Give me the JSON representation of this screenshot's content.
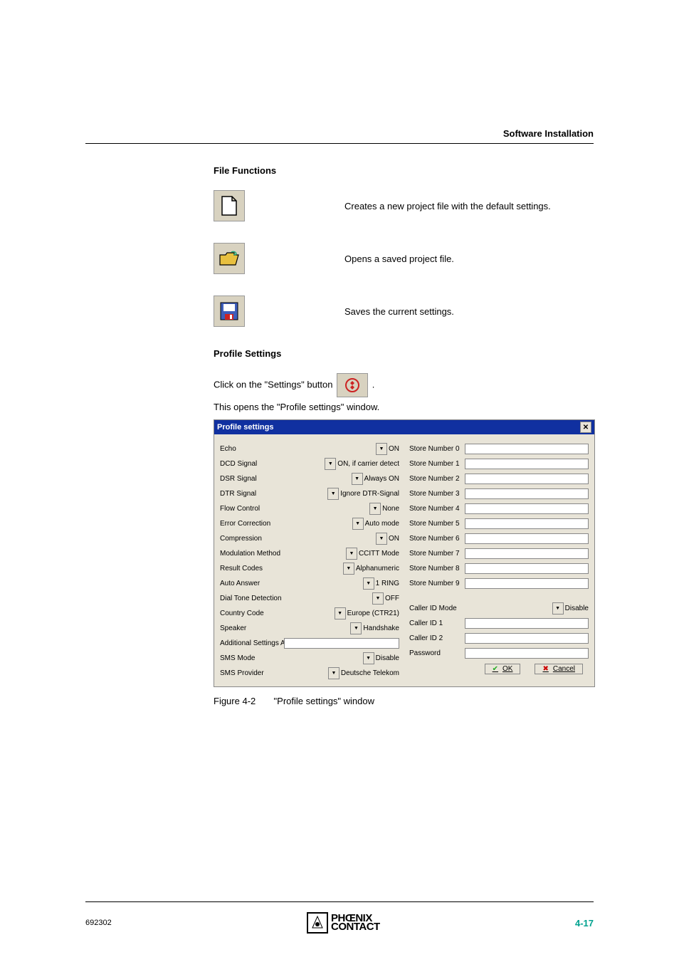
{
  "header": {
    "section": "Software Installation"
  },
  "fileFunctions": {
    "title": "File Functions",
    "items": [
      {
        "desc": "Creates a new project file with the default settings."
      },
      {
        "desc": "Opens a saved project file."
      },
      {
        "desc": "Saves the current settings."
      }
    ]
  },
  "profile": {
    "title": "Profile Settings",
    "line1a": "Click on the \"Settings\" button ",
    "line1b": ".",
    "line2": "This opens the \"Profile settings\" window."
  },
  "dialog": {
    "title": "Profile settings",
    "left": [
      {
        "label": "Echo",
        "value": "ON"
      },
      {
        "label": "DCD Signal",
        "value": "ON, if carrier detect"
      },
      {
        "label": "DSR Signal",
        "value": "Always ON"
      },
      {
        "label": "DTR Signal",
        "value": "Ignore DTR-Signal"
      },
      {
        "label": "Flow Control",
        "value": "None"
      },
      {
        "label": "Error Correction",
        "value": "Auto mode"
      },
      {
        "label": "Compression",
        "value": "ON"
      },
      {
        "label": "Modulation Method",
        "value": "CCITT Mode"
      },
      {
        "label": "Result Codes",
        "value": "Alphanumeric"
      },
      {
        "label": "Auto Answer",
        "value": "1 RING"
      },
      {
        "label": "Dial Tone Detection",
        "value": "OFF"
      },
      {
        "label": "Country Code",
        "value": "Europe (CTR21)"
      },
      {
        "label": "Speaker",
        "value": "Handshake"
      },
      {
        "label": "Additional Settings  AT",
        "value": "",
        "isText": true
      },
      {
        "label": "SMS Mode",
        "value": "Disable"
      },
      {
        "label": "SMS Provider",
        "value": "Deutsche Telekom"
      }
    ],
    "rightStores": [
      "Store Number 0",
      "Store Number 1",
      "Store Number 2",
      "Store Number 3",
      "Store Number 4",
      "Store Number 5",
      "Store Number 6",
      "Store Number 7",
      "Store Number 8",
      "Store Number 9"
    ],
    "rightExtra": [
      {
        "label": "Caller ID Mode",
        "value": "Disable",
        "type": "dd"
      },
      {
        "label": "Caller ID 1",
        "type": "text"
      },
      {
        "label": "Caller ID 2",
        "type": "text"
      },
      {
        "label": "Password",
        "type": "text"
      }
    ],
    "buttons": {
      "ok": "OK",
      "cancel": "Cancel"
    }
  },
  "figure": {
    "num": "Figure 4-2",
    "caption": "\"Profile settings\" window"
  },
  "footer": {
    "left": "692302",
    "right": "4-17",
    "brand1": "PHŒNIX",
    "brand2": "CONTACT"
  }
}
